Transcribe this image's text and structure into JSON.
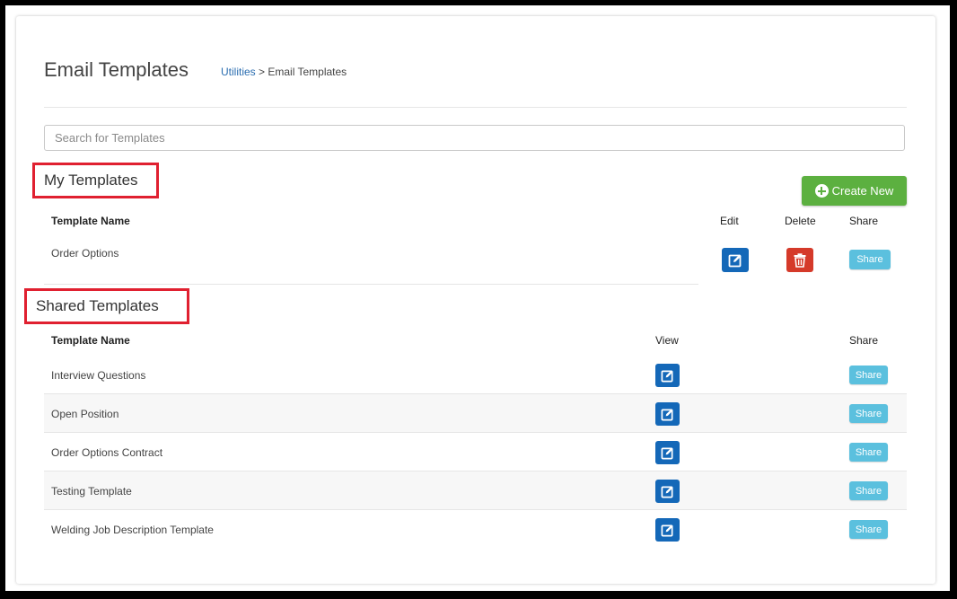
{
  "page": {
    "title": "Email Templates",
    "breadcrumb": {
      "link": "Utilities",
      "separator": " > ",
      "current": "Email Templates"
    }
  },
  "search": {
    "placeholder": "Search for Templates",
    "value": ""
  },
  "my_templates": {
    "title": "My Templates",
    "create_label": "Create New",
    "columns": {
      "name": "Template Name",
      "edit": "Edit",
      "delete": "Delete",
      "share": "Share"
    },
    "rows": [
      {
        "name": "Order Options",
        "share_label": "Share"
      }
    ]
  },
  "shared_templates": {
    "title": "Shared Templates",
    "columns": {
      "name": "Template Name",
      "view": "View",
      "share": "Share"
    },
    "rows": [
      {
        "name": "Interview Questions",
        "share_label": "Share"
      },
      {
        "name": "Open Position",
        "share_label": "Share"
      },
      {
        "name": "Order Options Contract",
        "share_label": "Share"
      },
      {
        "name": "Testing Template",
        "share_label": "Share"
      },
      {
        "name": "Welding Job Description Template",
        "share_label": "Share"
      }
    ]
  },
  "colors": {
    "primary": "#1468b8",
    "danger": "#d53a2a",
    "success": "#5cb040",
    "info": "#5bc0de",
    "highlight_border": "#e02030"
  },
  "icons": {
    "edit": "edit-icon",
    "delete": "trash-icon",
    "create": "plus-circle-icon"
  }
}
